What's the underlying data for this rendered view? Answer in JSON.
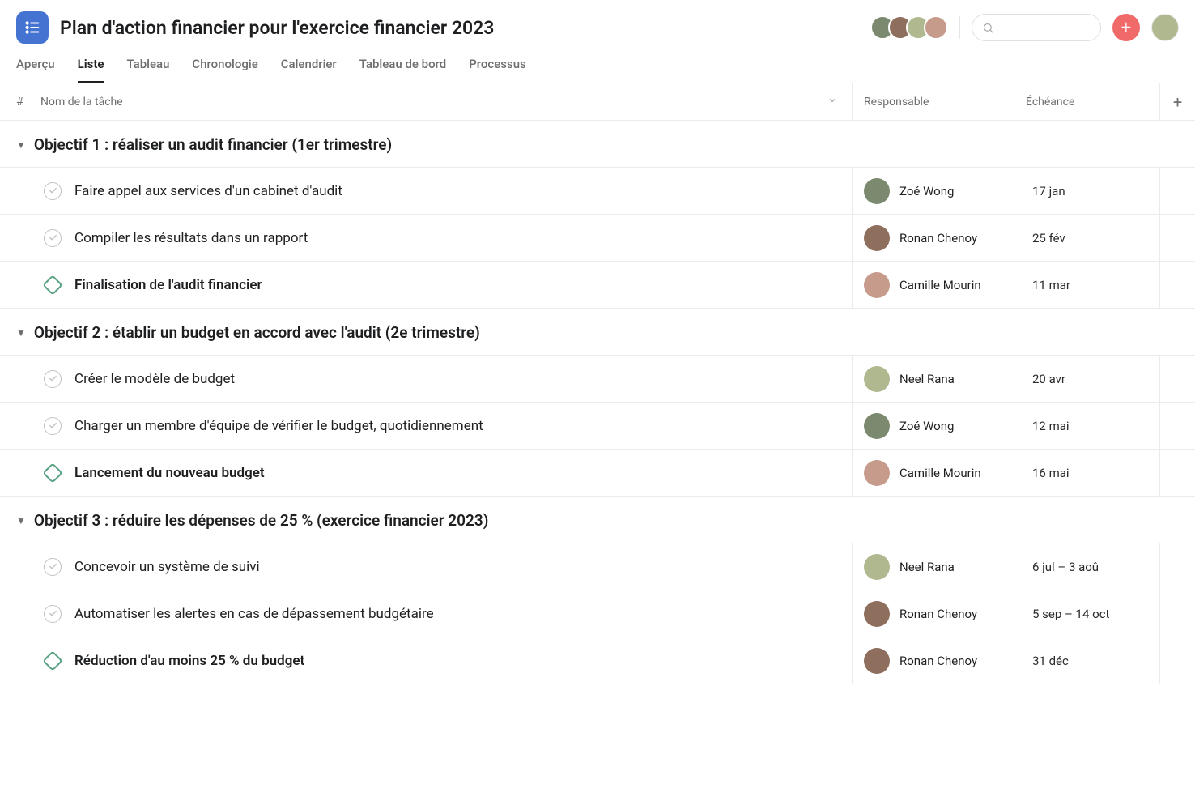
{
  "header": {
    "title": "Plan d'action financier pour l'exercice financier 2023",
    "search_placeholder": ""
  },
  "tabs": [
    {
      "label": "Aperçu",
      "active": false
    },
    {
      "label": "Liste",
      "active": true
    },
    {
      "label": "Tableau",
      "active": false
    },
    {
      "label": "Chronologie",
      "active": false
    },
    {
      "label": "Calendrier",
      "active": false
    },
    {
      "label": "Tableau de bord",
      "active": false
    },
    {
      "label": "Processus",
      "active": false
    }
  ],
  "columns": {
    "hash": "#",
    "name": "Nom de la tâche",
    "assignee": "Responsable",
    "due": "Échéance"
  },
  "sections": [
    {
      "title": "Objectif 1 : réaliser un audit financier (1er trimestre)",
      "rows": [
        {
          "type": "task",
          "name": "Faire appel aux services d'un cabinet d'audit",
          "assignee": "Zoé Wong",
          "avatar": "c1",
          "due": "17 jan"
        },
        {
          "type": "task",
          "name": "Compiler les résultats dans un rapport",
          "assignee": "Ronan Chenoy",
          "avatar": "c2",
          "due": "25 fév"
        },
        {
          "type": "milestone",
          "name": "Finalisation de l'audit financier",
          "assignee": "Camille Mourin",
          "avatar": "c3",
          "due": "11 mar"
        }
      ]
    },
    {
      "title": "Objectif 2 : établir un budget en accord avec l'audit (2e trimestre)",
      "rows": [
        {
          "type": "task",
          "name": "Créer le modèle de budget",
          "assignee": "Neel Rana",
          "avatar": "c4",
          "due": "20 avr"
        },
        {
          "type": "task",
          "name": "Charger un membre d'équipe de vérifier le budget, quotidiennement",
          "assignee": "Zoé Wong",
          "avatar": "c1",
          "due": "12 mai"
        },
        {
          "type": "milestone",
          "name": "Lancement du nouveau budget",
          "assignee": "Camille Mourin",
          "avatar": "c3",
          "due": "16 mai"
        }
      ]
    },
    {
      "title": "Objectif 3 : réduire les dépenses de 25 % (exercice financier 2023)",
      "rows": [
        {
          "type": "task",
          "name": "Concevoir un système de suivi",
          "assignee": "Neel Rana",
          "avatar": "c4",
          "due": "6 jul – 3 aoû"
        },
        {
          "type": "task",
          "name": "Automatiser les alertes en cas de dépassement budgétaire",
          "assignee": "Ronan Chenoy",
          "avatar": "c2",
          "due": "5 sep – 14 oct"
        },
        {
          "type": "milestone",
          "name": "Réduction d'au moins 25 % du budget",
          "assignee": "Ronan Chenoy",
          "avatar": "c2",
          "due": "31 déc"
        }
      ]
    }
  ],
  "header_avatars": [
    "c1",
    "c2",
    "c4",
    "c3"
  ]
}
